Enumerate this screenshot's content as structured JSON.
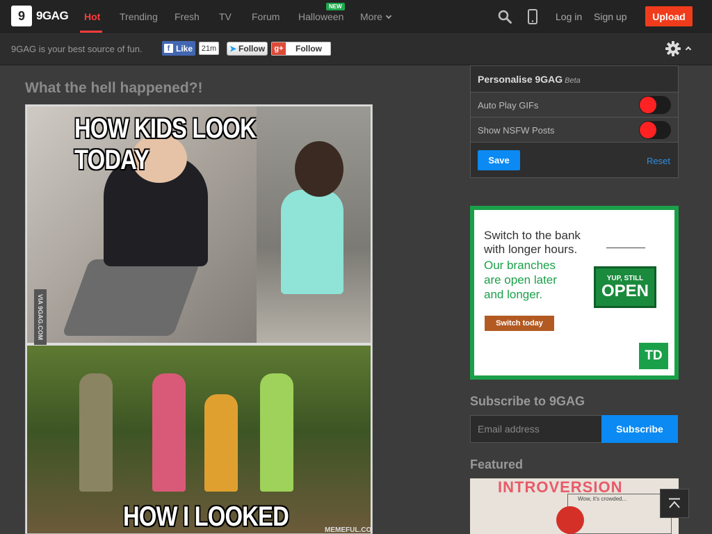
{
  "brand": {
    "logo_glyph": "9",
    "name": "9GAG"
  },
  "nav": {
    "items": [
      {
        "label": "Hot"
      },
      {
        "label": "Trending"
      },
      {
        "label": "Fresh"
      },
      {
        "label": "TV"
      },
      {
        "label": "Forum"
      },
      {
        "label": "Halloween"
      },
      {
        "label": "More"
      }
    ],
    "new_badge": "NEW",
    "login": "Log in",
    "signup": "Sign up",
    "upload": "Upload"
  },
  "subbar": {
    "tagline": "9GAG is your best source of fun.",
    "fb_like": "Like",
    "fb_glyph": "f",
    "fb_count": "21m",
    "twitter_follow": "Follow",
    "gplus_glyph": "g+",
    "gplus_follow": "Follow"
  },
  "post": {
    "title": "What the hell happened?!",
    "meme_top": "HOW KIDS LOOK TODAY",
    "meme_bottom": "HOW I LOOKED",
    "via": "VIA 9GAG.COM",
    "watermark": "MEMEFUL.COM"
  },
  "personalise": {
    "title": "Personalise 9GAG",
    "beta": "Beta",
    "options": [
      {
        "label": "Auto Play GIFs"
      },
      {
        "label": "Show NSFW Posts"
      }
    ],
    "save": "Save",
    "reset": "Reset"
  },
  "ad": {
    "line1a": "Switch to the bank",
    "line1b": "with longer hours.",
    "line2a": "Our branches",
    "line2b": "are open later",
    "line2c": "and longer.",
    "cta": "Switch today",
    "sign_small": "YUP, STILL",
    "sign_big": "OPEN",
    "logo": "TD"
  },
  "subscribe": {
    "title": "Subscribe to 9GAG",
    "placeholder": "Email address",
    "button": "Subscribe"
  },
  "featured": {
    "title": "Featured",
    "banner": "INTROVERSION",
    "caption": "Wow, it's crowded..."
  },
  "colors": {
    "accent": "#ff3b3b",
    "upload": "#f03c1c",
    "primary_button": "#0a8af2",
    "toggle_off": "#ff2222"
  }
}
